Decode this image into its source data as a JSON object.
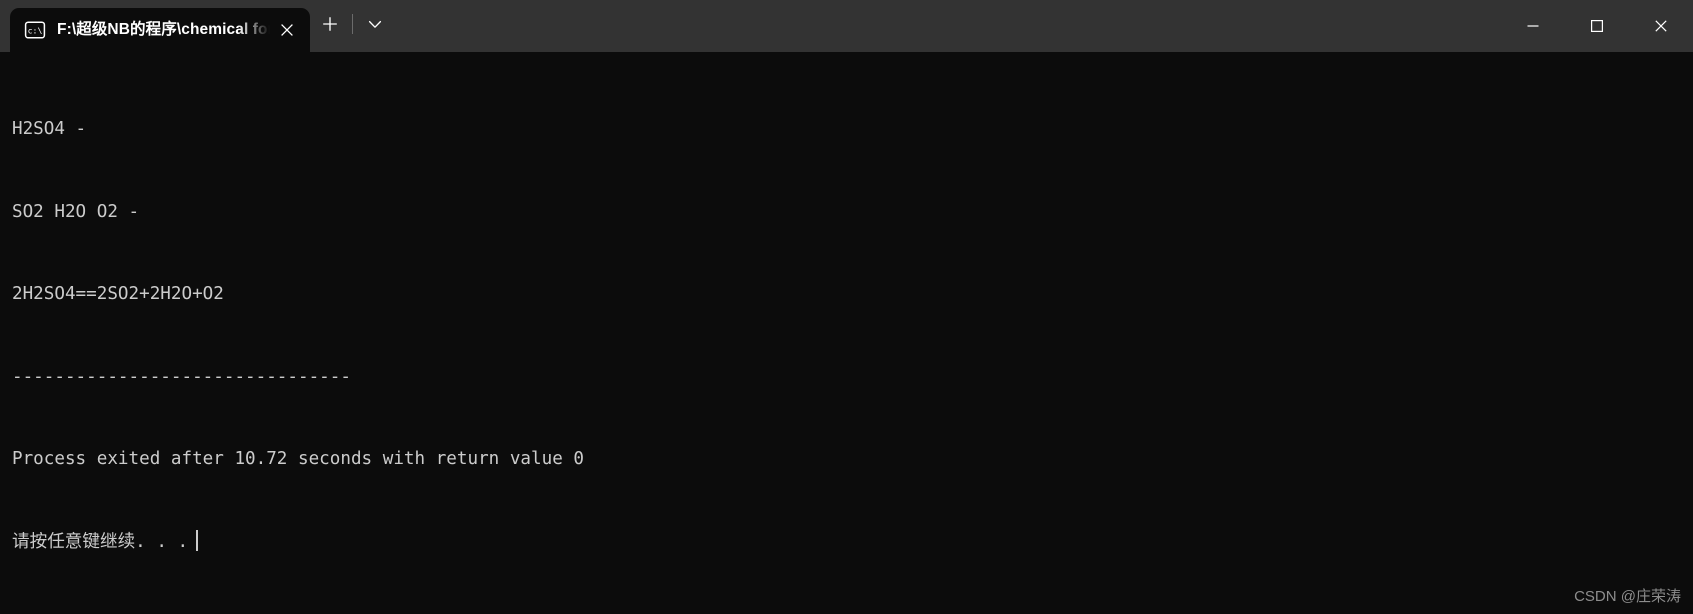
{
  "window": {
    "tab": {
      "icon_name": "console-icon",
      "icon_text": "c:\\",
      "title": "F:\\超级NB的程序\\chemical for",
      "close_label": "✕"
    },
    "new_tab_label": "+",
    "dropdown_label": "⌄",
    "controls": {
      "minimize_label": "─",
      "maximize_label": "□",
      "close_label": "✕"
    }
  },
  "terminal": {
    "lines": [
      "H2SO4 -",
      "SO2 H2O O2 -",
      "2H2SO4==2SO2+2H2O+O2",
      "--------------------------------",
      "Process exited after 10.72 seconds with return value 0",
      "请按任意键继续. . ."
    ],
    "foreground_color": "#cccccc",
    "background_color": "#0c0c0c"
  },
  "watermark": {
    "text": "CSDN @庄荣涛"
  }
}
